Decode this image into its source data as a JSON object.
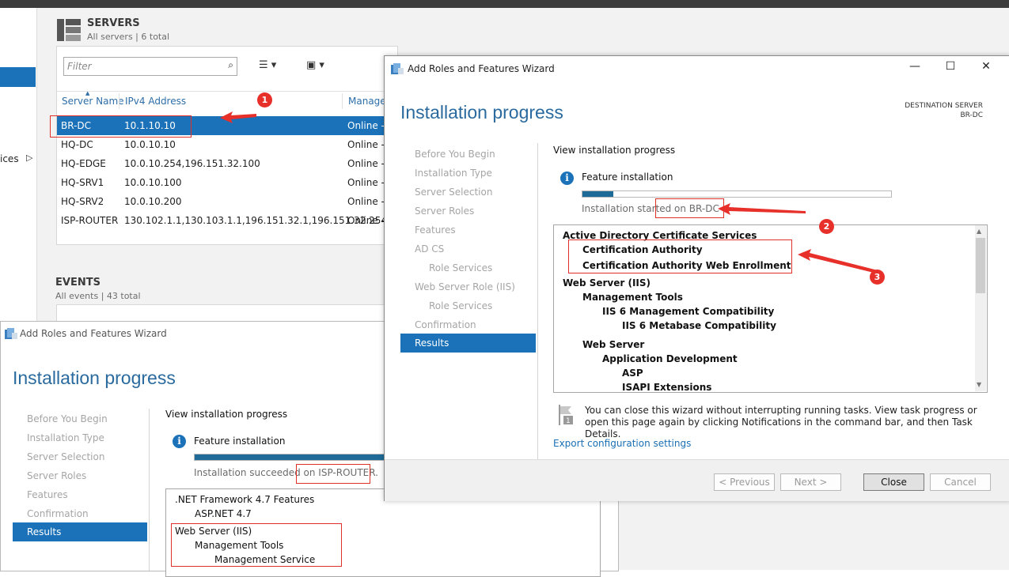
{
  "servers": {
    "title": "SERVERS",
    "subtitle": "All servers | 6 total",
    "filter_placeholder": "Filter",
    "columns": [
      "Server Name",
      "IPv4 Address",
      "Manageability"
    ],
    "rows": [
      {
        "name": "BR-DC",
        "ip": "10.1.10.10",
        "status": "Online -"
      },
      {
        "name": "HQ-DC",
        "ip": "10.0.10.10",
        "status": "Online -"
      },
      {
        "name": "HQ-EDGE",
        "ip": "10.0.10.254,196.151.32.100",
        "status": "Online -"
      },
      {
        "name": "HQ-SRV1",
        "ip": "10.0.10.100",
        "status": "Online -"
      },
      {
        "name": "HQ-SRV2",
        "ip": "10.0.10.200",
        "status": "Online -"
      },
      {
        "name": "ISP-ROUTER",
        "ip": "130.102.1.1,130.103.1.1,196.151.32.1,196.151.32.254",
        "status": "Online -"
      }
    ],
    "column_partial": "Managea"
  },
  "events": {
    "title": "EVENTS",
    "subtitle": "All events | 43 total"
  },
  "left_nav": {
    "partial": "ices"
  },
  "annotations": {
    "one": "1",
    "two": "2",
    "three": "3"
  },
  "wizard_back": {
    "window_title": "Add Roles and Features Wizard",
    "heading": "Installation progress",
    "nav": [
      "Before You Begin",
      "Installation Type",
      "Server Selection",
      "Server Roles",
      "Features",
      "Confirmation"
    ],
    "nav_selected": "Results",
    "view_progress": "View installation progress",
    "feature_installation": "Feature installation",
    "status_prefix": "Installation succeeded o",
    "status_server": "n ISP-ROUTER.",
    "progress": 1.0,
    "results": [
      {
        "text": ".NET Framework 4.7 Features",
        "level": 0
      },
      {
        "text": "ASP.NET 4.7",
        "level": 1
      },
      {
        "text": "Web Server (IIS)",
        "level": 0
      },
      {
        "text": "Management Tools",
        "level": 1
      },
      {
        "text": "Management Service",
        "level": 2
      }
    ]
  },
  "wizard_front": {
    "window_title": "Add Roles and Features Wizard",
    "heading": "Installation progress",
    "destination_label": "DESTINATION SERVER",
    "destination_server": "BR-DC",
    "nav": [
      {
        "label": "Before You Begin",
        "indent": 0
      },
      {
        "label": "Installation Type",
        "indent": 0
      },
      {
        "label": "Server Selection",
        "indent": 0
      },
      {
        "label": "Server Roles",
        "indent": 0
      },
      {
        "label": "Features",
        "indent": 0
      },
      {
        "label": "AD CS",
        "indent": 0
      },
      {
        "label": "Role Services",
        "indent": 1
      },
      {
        "label": "Web Server Role (IIS)",
        "indent": 0
      },
      {
        "label": "Role Services",
        "indent": 1
      },
      {
        "label": "Confirmation",
        "indent": 0
      }
    ],
    "nav_selected": "Results",
    "view_progress": "View installation progress",
    "feature_installation": "Feature installation",
    "status_prefix": "Installation started",
    "status_server": " on BR-DC",
    "progress": 0.1,
    "results": [
      {
        "text": "Active Directory Certificate Services",
        "level": 0
      },
      {
        "text": "Certification Authority",
        "level": 1
      },
      {
        "text": "Certification Authority Web Enrollment",
        "level": 1
      },
      {
        "text": "Web Server (IIS)",
        "level": 0
      },
      {
        "text": "Management Tools",
        "level": 1
      },
      {
        "text": "IIS 6 Management Compatibility",
        "level": 2
      },
      {
        "text": "IIS 6 Metabase Compatibility",
        "level": 3
      },
      {
        "text": "Web Server",
        "level": 1
      },
      {
        "text": "Application Development",
        "level": 2
      },
      {
        "text": "ASP",
        "level": 3
      },
      {
        "text": "ISAPI Extensions",
        "level": 3
      }
    ],
    "note": "You can close this wizard without interrupting running tasks. View task progress or open this page again by clicking Notifications in the command bar, and then Task Details.",
    "export_link": "Export configuration settings",
    "buttons": {
      "previous": "< Previous",
      "next": "Next >",
      "close": "Close",
      "cancel": "Cancel"
    }
  }
}
